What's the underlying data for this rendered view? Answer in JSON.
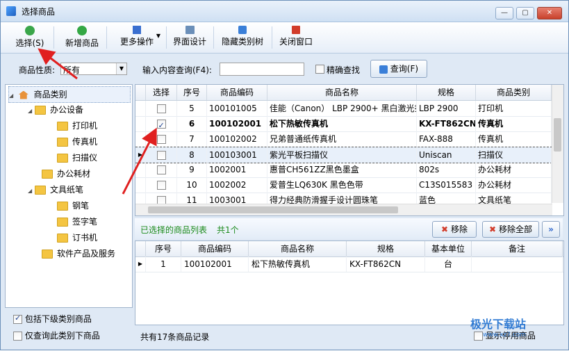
{
  "window": {
    "title": "选择商品"
  },
  "toolbar": {
    "select_label": "选择(S)",
    "add_product_label": "新增商品",
    "more_ops_label": "更多操作",
    "ui_design_label": "界面设计",
    "hide_tree_label": "隐藏类别树",
    "close_window_label": "关闭窗口"
  },
  "filter": {
    "nature_label": "商品性质:",
    "nature_value": "所有",
    "query_label": "输入内容查询(F4):",
    "query_value": "",
    "exact_label": "精确查找",
    "query_button": "查询(F)"
  },
  "tree": {
    "root": "商品类别",
    "items": [
      {
        "label": "办公设备"
      },
      {
        "label": "打印机"
      },
      {
        "label": "传真机"
      },
      {
        "label": "扫描仪"
      },
      {
        "label": "办公耗材"
      },
      {
        "label": "文具纸笔"
      },
      {
        "label": "钢笔"
      },
      {
        "label": "签字笔"
      },
      {
        "label": "订书机"
      },
      {
        "label": "软件产品及服务"
      }
    ],
    "include_sub_label": "包括下级类别商品",
    "only_this_label": "仅查询此类别下商品"
  },
  "product_grid": {
    "headers": [
      "选择",
      "序号",
      "商品编码",
      "商品名称",
      "规格",
      "商品类别"
    ],
    "rows": [
      {
        "checked": false,
        "no": "5",
        "code": "100101005",
        "name": "佳能（Canon） LBP 2900+ 黑白激光打",
        "spec": "LBP 2900",
        "cat": "打印机"
      },
      {
        "checked": true,
        "no": "6",
        "code": "100102001",
        "name": "松下热敏传真机",
        "spec": "KX-FT862CN",
        "cat": "传真机"
      },
      {
        "checked": false,
        "no": "7",
        "code": "100102002",
        "name": "兄弟普通纸传真机",
        "spec": "FAX-888",
        "cat": "传真机"
      },
      {
        "checked": false,
        "no": "8",
        "code": "100103001",
        "name": "紫光平板扫描仪",
        "spec": "Uniscan",
        "cat": "扫描仪"
      },
      {
        "checked": false,
        "no": "9",
        "code": "1002001",
        "name": "惠普CH561ZZ黑色墨盒",
        "spec": "802s",
        "cat": "办公耗材"
      },
      {
        "checked": false,
        "no": "10",
        "code": "1002002",
        "name": "爱普生LQ630K 黑色色带",
        "spec": "C13S015583",
        "cat": "办公耗材"
      },
      {
        "checked": false,
        "no": "11",
        "code": "1003001",
        "name": "得力经典防滑握手设计圆珠笔",
        "spec": "蓝色",
        "cat": "文具纸笔"
      }
    ]
  },
  "selected": {
    "title": "已选择的商品列表",
    "count_text": "共1个",
    "remove_label": "移除",
    "remove_all_label": "移除全部",
    "headers": [
      "序号",
      "商品编码",
      "商品名称",
      "规格",
      "基本单位",
      "备注"
    ],
    "rows": [
      {
        "no": "1",
        "code": "100102001",
        "name": "松下热敏传真机",
        "spec": "KX-FT862CN",
        "unit": "台",
        "note": ""
      }
    ]
  },
  "footer": {
    "record_text": "共有17条商品记录",
    "show_disabled_label": "显示停用商品"
  },
  "watermark": {
    "text": "极光下载站",
    "url": "www.xz7.com"
  },
  "colors": {
    "accent": "#1e5aa8",
    "selected_green": "#1a8a1a",
    "highlight_row": "#e8f0fa",
    "annotation_red": "#e02020"
  }
}
